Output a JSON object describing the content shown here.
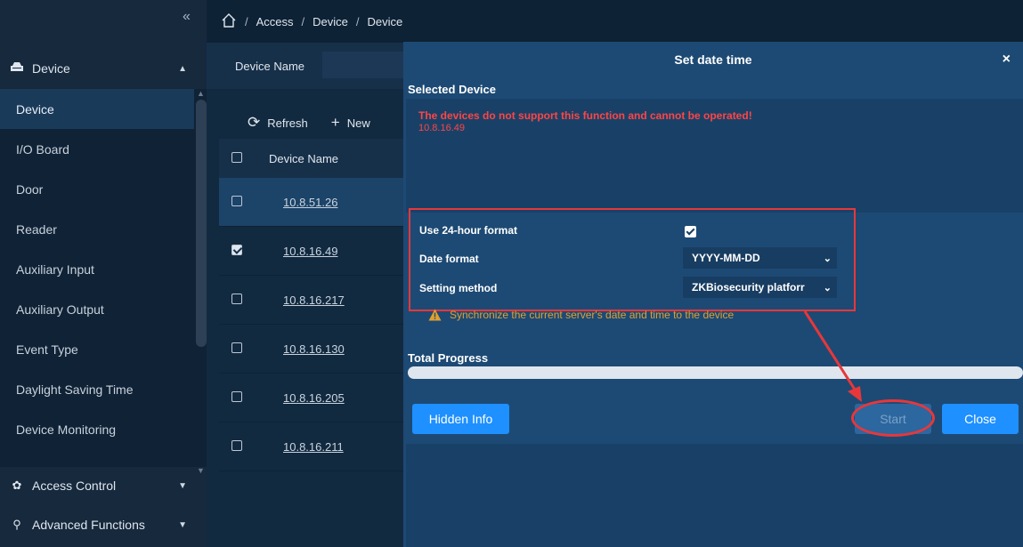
{
  "breadcrumb": {
    "items": [
      "Access",
      "Device",
      "Device"
    ],
    "separator": "/"
  },
  "sidebar": {
    "collapse_glyph": "«",
    "device_group": "Device",
    "items": [
      {
        "label": "Device",
        "active": true
      },
      {
        "label": "I/O Board"
      },
      {
        "label": "Door"
      },
      {
        "label": "Reader"
      },
      {
        "label": "Auxiliary Input"
      },
      {
        "label": "Auxiliary Output"
      },
      {
        "label": "Event Type"
      },
      {
        "label": "Daylight Saving Time"
      },
      {
        "label": "Device Monitoring"
      }
    ],
    "access_control": "Access Control",
    "advanced_functions": "Advanced Functions"
  },
  "filter": {
    "device_name_label": "Device Name"
  },
  "toolbar": {
    "refresh": "Refresh",
    "new": "New"
  },
  "table": {
    "header": "Device Name",
    "rows": [
      {
        "name": "10.8.51.26",
        "checked": false,
        "selected": true
      },
      {
        "name": "10.8.16.49",
        "checked": true
      },
      {
        "name": "10.8.16.217",
        "checked": false
      },
      {
        "name": "10.8.16.130",
        "checked": false
      },
      {
        "name": "10.8.16.205",
        "checked": false
      },
      {
        "name": "10.8.16.211",
        "checked": false
      }
    ]
  },
  "dialog": {
    "title": "Set date time",
    "close_glyph": "×",
    "selected_device_label": "Selected Device",
    "error_message": "The devices do not support this function and cannot be operated!",
    "error_device": "10.8.16.49",
    "use_24h_label": "Use 24-hour format",
    "use_24h_checked": true,
    "date_format_label": "Date format",
    "date_format_value": "YYYY-MM-DD",
    "setting_method_label": "Setting method",
    "setting_method_value": "ZKBiosecurity platforr",
    "warning_text": "Synchronize the current server's date and time to the device",
    "total_progress_label": "Total Progress",
    "progress": 0,
    "hidden_info_button": "Hidden Info",
    "start_button": "Start",
    "close_button": "Close"
  },
  "colors": {
    "accent": "#1e90ff",
    "error": "#ff4545",
    "warning": "#e0a030",
    "annotation": "#e8373a"
  }
}
